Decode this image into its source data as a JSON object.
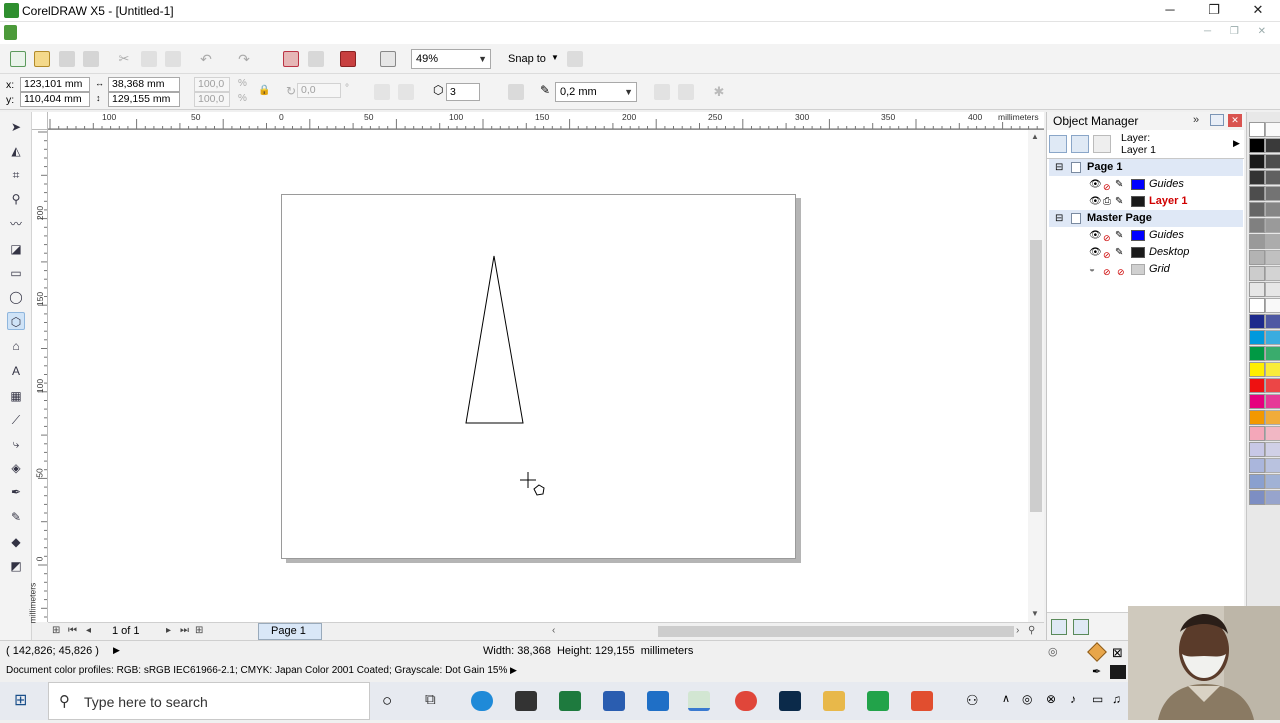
{
  "window": {
    "title": "CorelDRAW X5 - [Untitled-1]",
    "controls": {
      "minimize": "─",
      "restore": "❐",
      "close": "✕"
    }
  },
  "standard_toolbar": {
    "zoom": {
      "value": "49%"
    },
    "snap_to": {
      "label": "Snap to"
    }
  },
  "property_bar": {
    "x": {
      "label": "x:",
      "value": "123,101 mm"
    },
    "y": {
      "label": "y:",
      "value": "110,404 mm"
    },
    "width": {
      "value": "38,368 mm"
    },
    "height": {
      "value": "129,155 mm"
    },
    "scale_x": {
      "value": "100,0",
      "unit": "%"
    },
    "scale_y": {
      "value": "100,0",
      "unit": "%"
    },
    "rotation": {
      "value": "0,0",
      "unit": "°"
    },
    "sides": {
      "value": "3"
    },
    "outline_width": {
      "value": "0,2 mm"
    }
  },
  "ruler": {
    "unit": "millimeters",
    "h_ticks": [
      "100",
      "50",
      "0",
      "50",
      "100",
      "150",
      "200",
      "250",
      "300",
      "350",
      "400"
    ],
    "v_ticks": [
      "200",
      "150",
      "100",
      "50",
      "0"
    ],
    "v_unit": "millimeters"
  },
  "page_nav": {
    "count": "1 of 1",
    "tab": "Page 1"
  },
  "object_manager": {
    "title": "Object Manager",
    "layer_label": "Layer:",
    "current_layer": "Layer 1",
    "tree": [
      {
        "type": "page",
        "label": "Page 1",
        "expander": "⊟"
      },
      {
        "type": "layer",
        "label": "Guides",
        "color": "#0000ff",
        "style": "italic"
      },
      {
        "type": "layer",
        "label": "Layer 1",
        "color": "#1a1a1a",
        "style": "bold-red"
      },
      {
        "type": "page",
        "label": "Master Page",
        "expander": "⊟"
      },
      {
        "type": "layer",
        "label": "Guides",
        "color": "#0000ff",
        "style": "italic"
      },
      {
        "type": "layer",
        "label": "Desktop",
        "color": "#1a1a1a",
        "style": "italic"
      },
      {
        "type": "layer",
        "label": "Grid",
        "color": "#d0d0d0",
        "style": "italic"
      }
    ]
  },
  "palette": {
    "colors": [
      "#ffffff",
      "#000000",
      "#1a1a1a",
      "#333333",
      "#4d4d4d",
      "#666666",
      "#808080",
      "#999999",
      "#b3b3b3",
      "#cccccc",
      "#e6e6e6",
      "#ffffff",
      "#1d2a8c",
      "#0099dd",
      "#009944",
      "#ffee00",
      "#ee1111",
      "#e6007e",
      "#f39800",
      "#f4a7b9",
      "#c8c8e6",
      "#aab6dc",
      "#8aa0cf",
      "#7d8ec3"
    ]
  },
  "status": {
    "cursor": "( 142,826; 45,826 )",
    "dimensions": "Width: 38,368  Height: 129,155  millimeters",
    "color_profiles": "Document color profiles: RGB: sRGB IEC61966-2.1; CMYK: Japan Color 2001 Coated; Grayscale: Dot Gain 15%"
  },
  "taskbar": {
    "search_placeholder": "Type here to search"
  }
}
